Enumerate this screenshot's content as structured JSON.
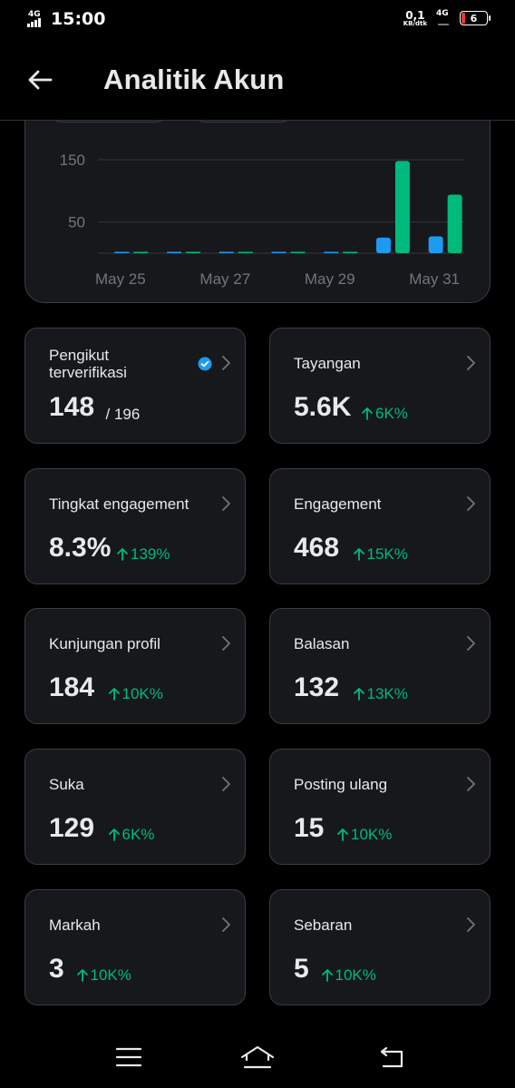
{
  "status_bar": {
    "network_left": "4G",
    "time": "15:00",
    "speed_value": "0,1",
    "speed_unit": "KB/dtk",
    "network_right": "4G",
    "battery_level": "6"
  },
  "header": {
    "title": "Analitik Akun"
  },
  "chart_data": {
    "type": "bar",
    "categories": [
      "May 25",
      "May 26",
      "May 27",
      "May 28",
      "May 29",
      "May 30",
      "May 31"
    ],
    "x_tick_labels": [
      "May 25",
      "May 27",
      "May 29",
      "May 31"
    ],
    "y_tick_labels": [
      "150",
      "50"
    ],
    "ylim": [
      0,
      170
    ],
    "series": [
      {
        "color": "#1d9bf0",
        "values": [
          0,
          0,
          0,
          0,
          0,
          25,
          27
        ]
      },
      {
        "color": "#00ba7c",
        "values": [
          1,
          0,
          0,
          0,
          0,
          148,
          94
        ]
      }
    ],
    "grid": true
  },
  "metrics": [
    {
      "label": "Pengikut terverifikasi",
      "value": "148",
      "sub": "/ 196",
      "verified": true
    },
    {
      "label": "Tayangan",
      "value": "5.6K",
      "change": "6K%"
    },
    {
      "label": "Tingkat engagement",
      "value": "8.3%",
      "change": "139%"
    },
    {
      "label": "Engagement",
      "value": "468",
      "change": "15K%"
    },
    {
      "label": "Kunjungan profil",
      "value": "184",
      "change": "10K%"
    },
    {
      "label": "Balasan",
      "value": "132",
      "change": "13K%"
    },
    {
      "label": "Suka",
      "value": "129",
      "change": "6K%"
    },
    {
      "label": "Posting ulang",
      "value": "15",
      "change": "10K%"
    },
    {
      "label": "Markah",
      "value": "3",
      "change": "10K%"
    },
    {
      "label": "Sebaran",
      "value": "5",
      "change": "10K%"
    }
  ],
  "colors": {
    "accent_blue": "#1d9bf0",
    "positive_green": "#00ba7c",
    "card_bg": "#16181c",
    "border": "#3a3d42"
  },
  "icons": {
    "back": "arrow-left-icon",
    "chevron": "chevron-right-icon",
    "verified": "verified-badge-icon",
    "up": "arrow-up-icon"
  }
}
